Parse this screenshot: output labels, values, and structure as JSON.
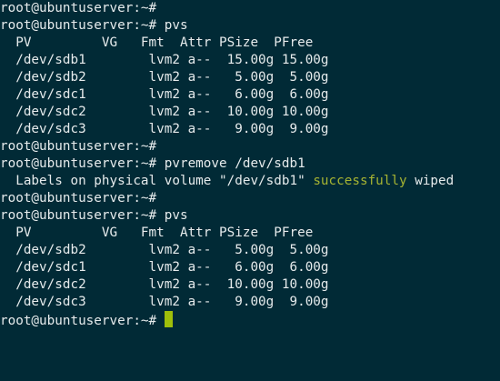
{
  "terminal": {
    "accent_color": "#9fbf0a",
    "success_color": "#a6b432",
    "background_color": "#012a36",
    "text_color": "#e6ebec",
    "lines": [
      "root@ubuntuserver:~#",
      "root@ubuntuserver:~# pvs",
      "  PV         VG   Fmt  Attr PSize  PFree",
      "  /dev/sdb1        lvm2 a--  15.00g 15.00g",
      "  /dev/sdb2        lvm2 a--   5.00g  5.00g",
      "  /dev/sdc1        lvm2 a--   6.00g  6.00g",
      "  /dev/sdc2        lvm2 a--  10.00g 10.00g",
      "  /dev/sdc3        lvm2 a--   9.00g  9.00g",
      "root@ubuntuserver:~#",
      "root@ubuntuserver:~# pvremove /dev/sdb1",
      {
        "before": "  Labels on physical volume \"/dev/sdb1\" ",
        "highlight": "successfully",
        "after": " wiped"
      },
      "root@ubuntuserver:~#",
      "root@ubuntuserver:~# pvs",
      "  PV         VG   Fmt  Attr PSize  PFree",
      "  /dev/sdb2        lvm2 a--   5.00g  5.00g",
      "  /dev/sdc1        lvm2 a--   6.00g  6.00g",
      "  /dev/sdc2        lvm2 a--  10.00g 10.00g",
      "  /dev/sdc3        lvm2 a--   9.00g  9.00g",
      "root@ubuntuserver:~# "
    ]
  }
}
